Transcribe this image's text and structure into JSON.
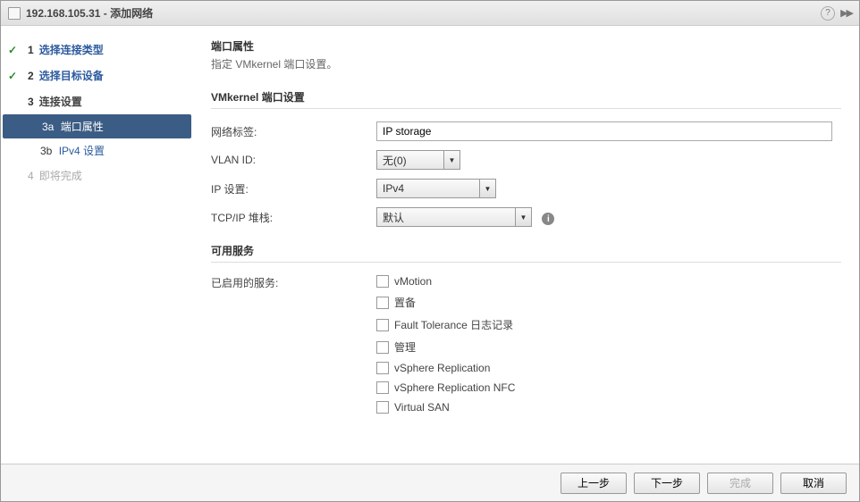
{
  "titlebar": {
    "text": "192.168.105.31 - 添加网络"
  },
  "sidebar": {
    "steps": [
      {
        "num": "1",
        "label": "选择连接类型",
        "state": "completed"
      },
      {
        "num": "2",
        "label": "选择目标设备",
        "state": "completed"
      },
      {
        "num": "3",
        "label": "连接设置",
        "state": "current"
      },
      {
        "num": "4",
        "label": "即将完成",
        "state": "disabled"
      }
    ],
    "substeps": [
      {
        "num": "3a",
        "label": "端口属性",
        "active": true
      },
      {
        "num": "3b",
        "label": "IPv4 设置",
        "active": false
      }
    ]
  },
  "content": {
    "title": "端口属性",
    "desc": "指定 VMkernel 端口设置。",
    "section1": "VMkernel 端口设置",
    "section2": "可用服务",
    "labels": {
      "network_label": "网络标签:",
      "vlan_id": "VLAN ID:",
      "ip_settings": "IP 设置:",
      "tcpip_stack": "TCP/IP 堆栈:",
      "enabled_services": "已启用的服务:"
    },
    "values": {
      "network_label": "IP storage",
      "vlan_id": "无(0)",
      "ip_settings": "IPv4",
      "tcpip_stack": "默认"
    },
    "services": [
      "vMotion",
      "置备",
      "Fault Tolerance 日志记录",
      "管理",
      "vSphere Replication",
      "vSphere Replication NFC",
      "Virtual SAN"
    ]
  },
  "footer": {
    "back": "上一步",
    "next": "下一步",
    "finish": "完成",
    "cancel": "取消"
  }
}
